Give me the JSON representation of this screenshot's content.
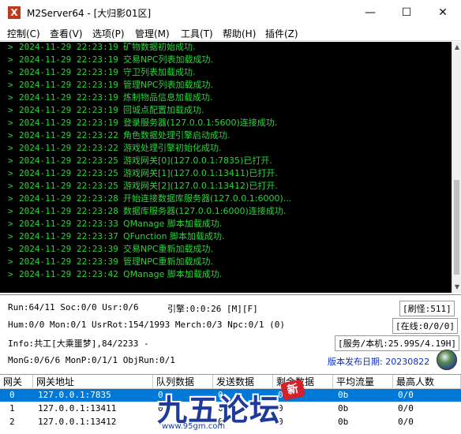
{
  "window": {
    "app_icon_glyph": "X",
    "title": "M2Server64 - [大归影01区]",
    "minimize_glyph": "—",
    "maximize_glyph": "☐",
    "close_glyph": "✕"
  },
  "menu": [
    "控制(C)",
    "查看(V)",
    "选项(P)",
    "管理(M)",
    "工具(T)",
    "帮助(H)",
    "插件(Z)"
  ],
  "log": [
    {
      "arrow": ">",
      "time": "2024-11-29 22:23:19",
      "msg": "矿物数据初始成功."
    },
    {
      "arrow": ">",
      "time": "2024-11-29 22:23:19",
      "msg": "交易NPC列表加载成功."
    },
    {
      "arrow": ">",
      "time": "2024-11-29 22:23:19",
      "msg": "守卫列表加载成功."
    },
    {
      "arrow": ">",
      "time": "2024-11-29 22:23:19",
      "msg": "管理NPC列表加载成功."
    },
    {
      "arrow": ">",
      "time": "2024-11-29 22:23:19",
      "msg": "炼制物品信息加载成功."
    },
    {
      "arrow": ">",
      "time": "2024-11-29 22:23:19",
      "msg": "回城点配置加载成功."
    },
    {
      "arrow": ">",
      "time": "2024-11-29 22:23:19",
      "msg": "登录服务器(127.0.0.1:5600)连接成功."
    },
    {
      "arrow": ">",
      "time": "2024-11-29 22:23:22",
      "msg": "角色数据处理引擎启动成功."
    },
    {
      "arrow": ">",
      "time": "2024-11-29 22:23:22",
      "msg": "游戏处理引擎初始化成功."
    },
    {
      "arrow": ">",
      "time": "2024-11-29 22:23:25",
      "msg": "游戏网关[0](127.0.0.1:7835)已打开."
    },
    {
      "arrow": ">",
      "time": "2024-11-29 22:23:25",
      "msg": "游戏网关[1](127.0.0.1:13411)已打开."
    },
    {
      "arrow": ">",
      "time": "2024-11-29 22:23:25",
      "msg": "游戏网关[2](127.0.0.1:13412)已打开."
    },
    {
      "arrow": ">",
      "time": "2024-11-29 22:23:28",
      "msg": "开始连接数据库服务器(127.0.0.1:6000)..."
    },
    {
      "arrow": ">",
      "time": "2024-11-29 22:23:28",
      "msg": "数据库服务器(127.0.0.1:6000)连接成功."
    },
    {
      "arrow": ">",
      "time": "2024-11-29 22:23:33",
      "msg": "QManage 脚本加载成功."
    },
    {
      "arrow": ">",
      "time": "2024-11-29 22:23:37",
      "msg": "QFunction 脚本加载成功."
    },
    {
      "arrow": ">",
      "time": "2024-11-29 22:23:39",
      "msg": "交易NPC重新加载成功."
    },
    {
      "arrow": ">",
      "time": "2024-11-29 22:23:39",
      "msg": "管理NPC重新加载成功."
    },
    {
      "arrow": ">",
      "time": "2024-11-29 22:23:42",
      "msg": "QManage 脚本加载成功."
    }
  ],
  "scrollbar": {
    "up_glyph": "▲",
    "down_glyph": "▼"
  },
  "status": {
    "run": "Run:64/11 Soc:0/0 Usr:0/6",
    "engine": "引擎:0:0:26 [M][F]",
    "refresh": "[刷怪:511]",
    "hum": "Hum:0/0 Mon:0/1 UsrRot:154/1993 Merch:0/3 Npc:0/1 (0)",
    "online": "[在线:0/0/0]",
    "info": "Info:共工[大乘噩梦],84/2233 -",
    "service": "[服务/本机:25.99S/4.19H]",
    "mon": "MonG:0/6/6 MonP:0/1/1 ObjRun:0/1",
    "version": "版本发布日期: 20230822"
  },
  "gateway_table": {
    "headers": [
      "网关",
      "网关地址",
      "队列数据",
      "发送数据",
      "剩余数据",
      "平均流量",
      "最高人数"
    ],
    "rows": [
      [
        "0",
        "127.0.0.1:7835",
        "0",
        "0",
        "0",
        "0b",
        "0/0"
      ],
      [
        "1",
        "127.0.0.1:13411",
        "0",
        "0",
        "0",
        "0b",
        "0/0"
      ],
      [
        "2",
        "127.0.0.1:13412",
        "0",
        "0",
        "0",
        "0b",
        "0/0"
      ]
    ]
  },
  "watermark": {
    "text": "九五论坛",
    "badge": "新",
    "url": "www.95gm.com"
  }
}
